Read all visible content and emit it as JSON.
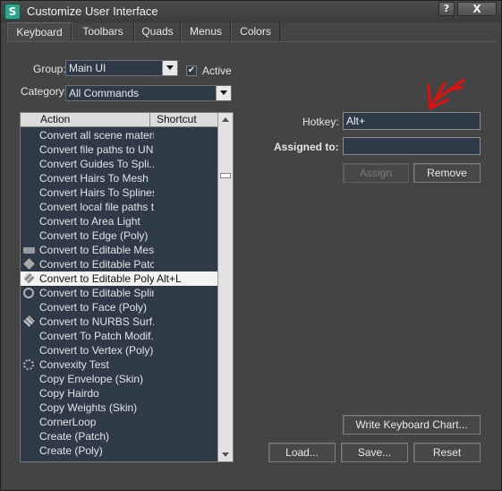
{
  "window": {
    "title": "Customize User Interface",
    "app_icon_glyph": "S",
    "help_glyph": "?",
    "close_glyph": "X"
  },
  "tabs": [
    {
      "label": "Keyboard",
      "active": true
    },
    {
      "label": "Toolbars",
      "active": false
    },
    {
      "label": "Quads",
      "active": false
    },
    {
      "label": "Menus",
      "active": false
    },
    {
      "label": "Colors",
      "active": false
    }
  ],
  "group": {
    "label": "Group:",
    "value": "Main UI"
  },
  "active_checkbox": {
    "label": "Active",
    "checked": true,
    "check_glyph": "✔"
  },
  "category": {
    "label": "Category:",
    "value": "All Commands"
  },
  "action_list": {
    "columns": {
      "action": "Action",
      "shortcut": "Shortcut"
    },
    "rows": [
      {
        "icon": "",
        "action": "Convert all scene materi...",
        "shortcut": ""
      },
      {
        "icon": "",
        "action": "Convert file paths to UNC",
        "shortcut": ""
      },
      {
        "icon": "",
        "action": "Convert Guides To Spli...",
        "shortcut": ""
      },
      {
        "icon": "",
        "action": "Convert Hairs To Mesh",
        "shortcut": ""
      },
      {
        "icon": "",
        "action": "Convert Hairs To Splines",
        "shortcut": ""
      },
      {
        "icon": "",
        "action": "Convert local file paths t...",
        "shortcut": ""
      },
      {
        "icon": "",
        "action": "Convert to Area Light",
        "shortcut": ""
      },
      {
        "icon": "",
        "action": "Convert to Edge (Poly)",
        "shortcut": ""
      },
      {
        "icon": "mesh",
        "action": "Convert to Editable Mesh",
        "shortcut": ""
      },
      {
        "icon": "patch",
        "action": "Convert to Editable Patch",
        "shortcut": ""
      },
      {
        "icon": "poly",
        "action": "Convert to Editable Poly...",
        "shortcut": "Alt+L",
        "selected": true
      },
      {
        "icon": "spline",
        "action": "Convert to Editable Spline",
        "shortcut": ""
      },
      {
        "icon": "",
        "action": "Convert to Face (Poly)",
        "shortcut": ""
      },
      {
        "icon": "nurbs",
        "action": "Convert to NURBS Surf...",
        "shortcut": ""
      },
      {
        "icon": "",
        "action": "Convert To Patch Modif...",
        "shortcut": ""
      },
      {
        "icon": "",
        "action": "Convert to Vertex (Poly)",
        "shortcut": ""
      },
      {
        "icon": "convex",
        "action": "Convexity Test",
        "shortcut": ""
      },
      {
        "icon": "",
        "action": "Copy Envelope (Skin)",
        "shortcut": ""
      },
      {
        "icon": "",
        "action": "Copy Hairdo",
        "shortcut": ""
      },
      {
        "icon": "",
        "action": "Copy Weights (Skin)",
        "shortcut": ""
      },
      {
        "icon": "",
        "action": "CornerLoop",
        "shortcut": ""
      },
      {
        "icon": "",
        "action": "Create (Patch)",
        "shortcut": ""
      },
      {
        "icon": "",
        "action": "Create (Poly)",
        "shortcut": ""
      }
    ]
  },
  "hotkey": {
    "label": "Hotkey:",
    "value": "Alt+"
  },
  "assigned_to": {
    "label": "Assigned to:",
    "value": ""
  },
  "buttons": {
    "assign": "Assign",
    "remove": "Remove",
    "write_chart": "Write Keyboard Chart...",
    "load": "Load...",
    "save": "Save...",
    "reset": "Reset"
  },
  "annotation": {
    "color": "#e01010",
    "icon": "red-arrow-annotation"
  }
}
